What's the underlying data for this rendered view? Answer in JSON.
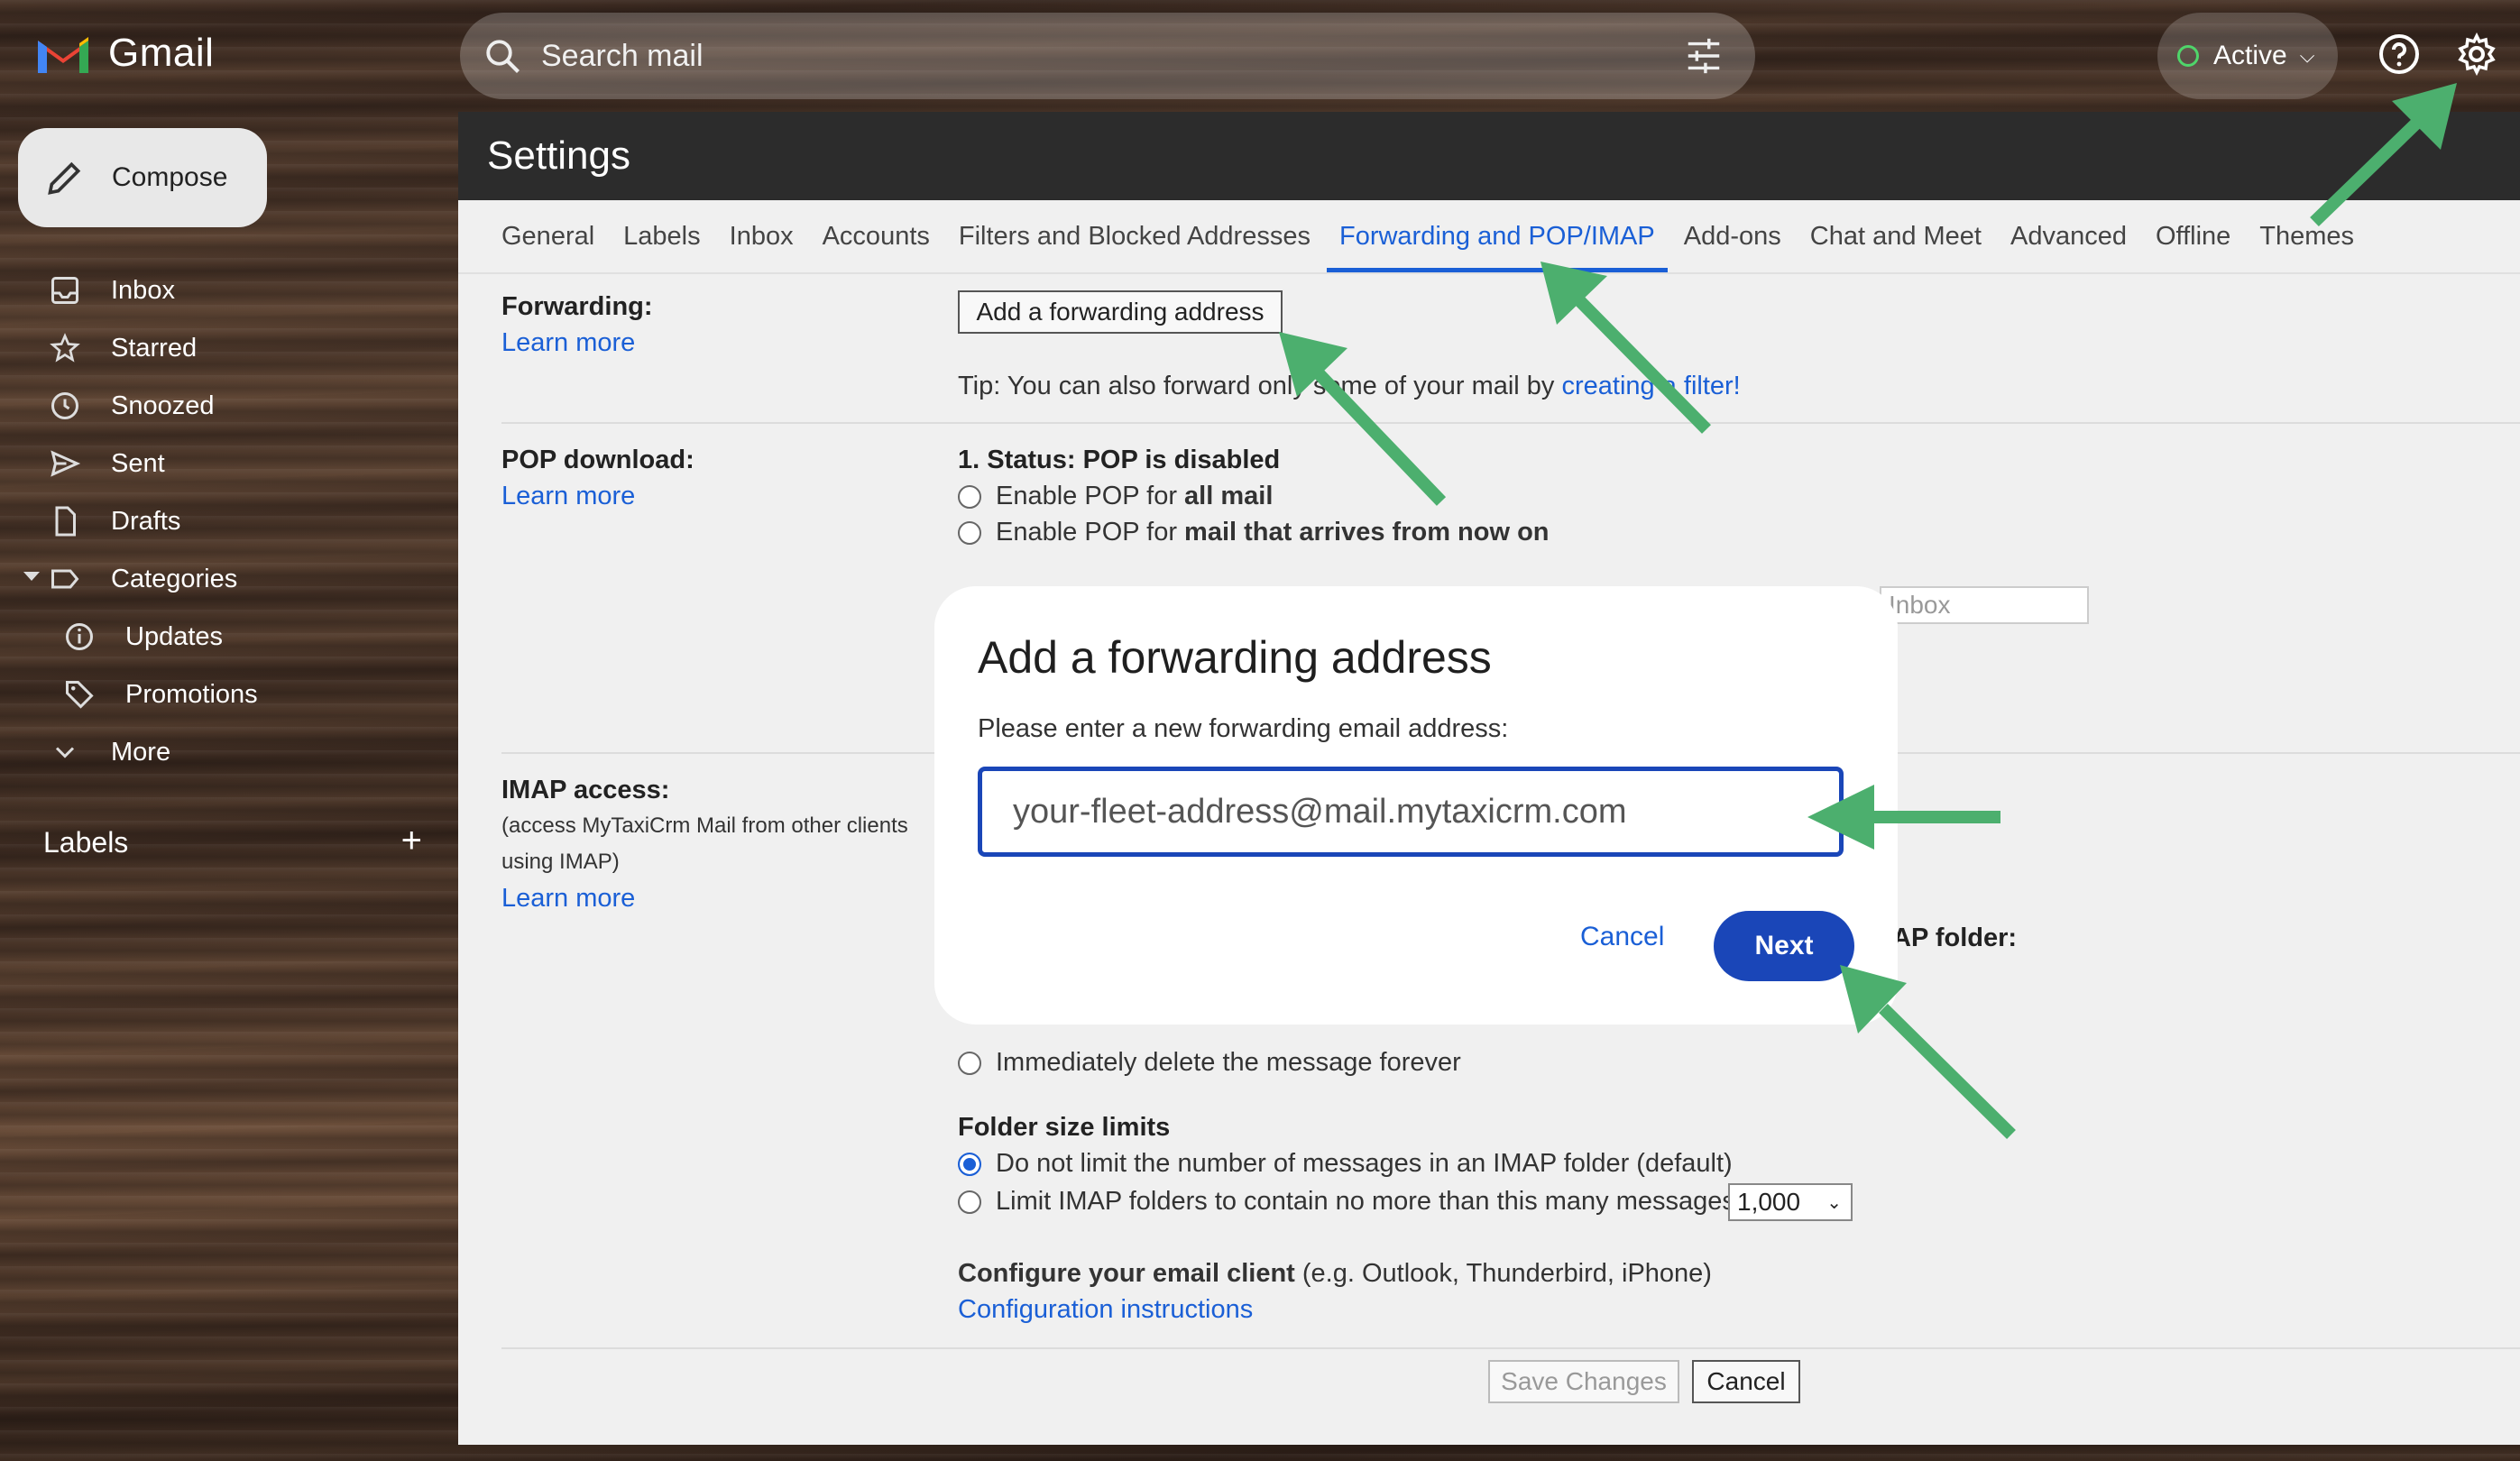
{
  "header": {
    "app_name": "Gmail",
    "search_placeholder": "Search mail",
    "status_label": "Active"
  },
  "sidebar": {
    "compose_label": "Compose",
    "items": [
      {
        "label": "Inbox",
        "icon": "inbox-icon"
      },
      {
        "label": "Starred",
        "icon": "star-icon"
      },
      {
        "label": "Snoozed",
        "icon": "clock-icon"
      },
      {
        "label": "Sent",
        "icon": "send-icon"
      },
      {
        "label": "Drafts",
        "icon": "file-icon"
      },
      {
        "label": "Categories",
        "icon": "label-icon"
      },
      {
        "label": "Updates",
        "icon": "info-icon"
      },
      {
        "label": "Promotions",
        "icon": "tag-icon"
      },
      {
        "label": "More",
        "icon": "chevron-down-icon"
      }
    ],
    "labels_heading": "Labels"
  },
  "settings": {
    "title": "Settings",
    "tabs": [
      "General",
      "Labels",
      "Inbox",
      "Accounts",
      "Filters and Blocked Addresses",
      "Forwarding and POP/IMAP",
      "Add-ons",
      "Chat and Meet",
      "Advanced",
      "Offline",
      "Themes"
    ],
    "active_tab": "Forwarding and POP/IMAP",
    "forwarding": {
      "label": "Forwarding:",
      "learn_more": "Learn more",
      "add_button": "Add a forwarding address",
      "tip_prefix": "Tip: You can also forward only some of your mail by ",
      "tip_link": "creating a filter!"
    },
    "pop": {
      "label": "POP download:",
      "learn_more": "Learn more",
      "status": "1. Status: POP is disabled",
      "option1_prefix": "Enable POP for ",
      "option1_bold": "all mail",
      "option2_prefix": "Enable POP for ",
      "option2_bold": "mail that arrives from now on",
      "select_value": "Inbox"
    },
    "imap": {
      "label": "IMAP access:",
      "desc_line1": "(access MyTaxiCrm Mail from other clients",
      "desc_line2": "using IMAP)",
      "learn_more": "Learn more",
      "folder_suffix": "AP folder:",
      "delete_option": "Immediately delete the message forever",
      "folder_size_heading": "Folder size limits",
      "limit_option1": "Do not limit the number of messages in an IMAP folder (default)",
      "limit_option2": "Limit IMAP folders to contain no more than this many messages",
      "limit_value": "1,000",
      "configure_bold": "Configure your email client",
      "configure_rest": " (e.g. Outlook, Thunderbird, iPhone)",
      "config_link": "Configuration instructions"
    },
    "footer": {
      "save": "Save Changes",
      "cancel": "Cancel"
    }
  },
  "modal": {
    "title": "Add a forwarding address",
    "prompt": "Please enter a new forwarding email address:",
    "input_value": "your-fleet-address@mail.mytaxicrm.com",
    "cancel": "Cancel",
    "next": "Next"
  },
  "colors": {
    "accent": "#1a5fd6",
    "primary_button": "#1a46b8",
    "annotation_arrow": "#4caf6e"
  }
}
